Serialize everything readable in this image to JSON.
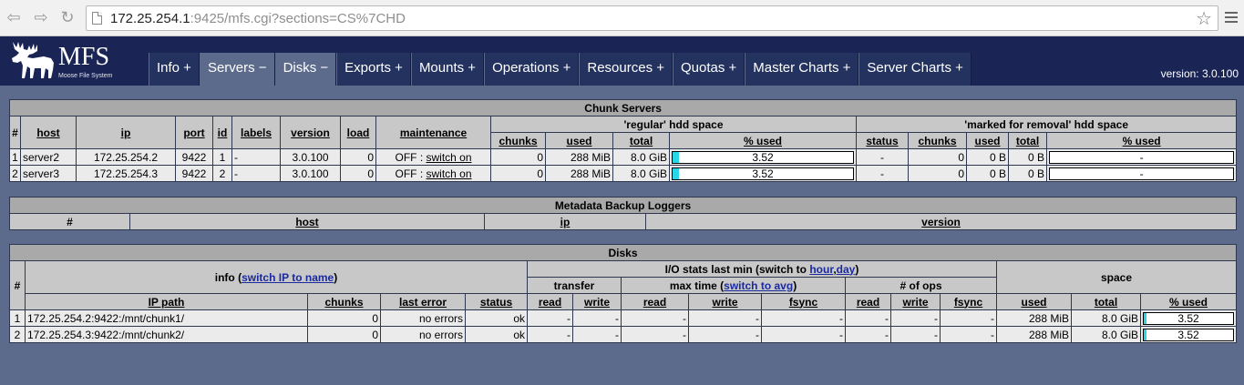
{
  "browser": {
    "url_host": "172.25.254.1",
    "url_rest": ":9425/mfs.cgi?sections=CS%7CHD"
  },
  "header": {
    "logo_text": "MFS",
    "logo_sub": "Moose File System",
    "version": "version: 3.0.100",
    "tabs": [
      {
        "label": "Info +",
        "active": false
      },
      {
        "label": "Servers −",
        "active": true
      },
      {
        "label": "Disks −",
        "active": true
      },
      {
        "label": "Exports +",
        "active": false
      },
      {
        "label": "Mounts +",
        "active": false
      },
      {
        "label": "Operations +",
        "active": false
      },
      {
        "label": "Resources +",
        "active": false
      },
      {
        "label": "Quotas +",
        "active": false
      },
      {
        "label": "Master Charts +",
        "active": false
      },
      {
        "label": "Server Charts +",
        "active": false
      }
    ]
  },
  "chunk_servers": {
    "title": "Chunk Servers",
    "col": {
      "num": "#",
      "host": "host",
      "ip": "ip",
      "port": "port",
      "id": "id",
      "labels": "labels",
      "version": "version",
      "load": "load",
      "maintenance": "maintenance"
    },
    "regular_title": "'regular' hdd space",
    "removal_title": "'marked for removal' hdd space",
    "sub": {
      "chunks": "chunks",
      "used": "used",
      "total": "total",
      "pct": "% used",
      "status": "status"
    },
    "rows": [
      {
        "num": "1",
        "host": "server2",
        "ip": "172.25.254.2",
        "port": "9422",
        "id": "1",
        "labels": "-",
        "version": "3.0.100",
        "load": "0",
        "maint_state": "OFF : ",
        "maint_link": "switch on",
        "chunks": "0",
        "used": "288 MiB",
        "total": "8.0 GiB",
        "pct": "3.52",
        "pct_value": 3.52,
        "r_status": "-",
        "r_chunks": "0",
        "r_used": "0 B",
        "r_total": "0 B",
        "r_pct": "-"
      },
      {
        "num": "2",
        "host": "server3",
        "ip": "172.25.254.3",
        "port": "9422",
        "id": "2",
        "labels": "-",
        "version": "3.0.100",
        "load": "0",
        "maint_state": "OFF : ",
        "maint_link": "switch on",
        "chunks": "0",
        "used": "288 MiB",
        "total": "8.0 GiB",
        "pct": "3.52",
        "pct_value": 3.52,
        "r_status": "-",
        "r_chunks": "0",
        "r_used": "0 B",
        "r_total": "0 B",
        "r_pct": "-"
      }
    ]
  },
  "metaloggers": {
    "title": "Metadata Backup Loggers",
    "col": {
      "num": "#",
      "host": "host",
      "ip": "ip",
      "version": "version"
    }
  },
  "disks": {
    "title": "Disks",
    "info_prefix": "info (",
    "info_link": "switch IP to name",
    "info_suffix": ")",
    "io_prefix": "I/O stats last min (switch to ",
    "io_link_hour": "hour",
    "io_sep": ",",
    "io_link_day": "day",
    "io_suffix": ")",
    "space": "space",
    "transfer": "transfer",
    "maxtime_prefix": "max time (",
    "maxtime_link": "switch to avg",
    "maxtime_suffix": ")",
    "ops": "# of ops",
    "col": {
      "num": "#",
      "path": "IP path",
      "chunks": "chunks",
      "last_error": "last error",
      "status": "status",
      "read": "read",
      "write": "write",
      "fsync": "fsync",
      "used": "used",
      "total": "total",
      "pct": "% used"
    },
    "rows": [
      {
        "num": "1",
        "path": "172.25.254.2:9422:/mnt/chunk1/",
        "chunks": "0",
        "last_error": "no errors",
        "status": "ok",
        "t_read": "-",
        "t_write": "-",
        "m_read": "-",
        "m_write": "-",
        "m_fsync": "-",
        "o_read": "-",
        "o_write": "-",
        "o_fsync": "-",
        "used": "288 MiB",
        "total": "8.0 GiB",
        "pct": "3.52",
        "pct_value": 3.52
      },
      {
        "num": "2",
        "path": "172.25.254.3:9422:/mnt/chunk2/",
        "chunks": "0",
        "last_error": "no errors",
        "status": "ok",
        "t_read": "-",
        "t_write": "-",
        "m_read": "-",
        "m_write": "-",
        "m_fsync": "-",
        "o_read": "-",
        "o_write": "-",
        "o_fsync": "-",
        "used": "288 MiB",
        "total": "8.0 GiB",
        "pct": "3.52",
        "pct_value": 3.52
      }
    ]
  }
}
